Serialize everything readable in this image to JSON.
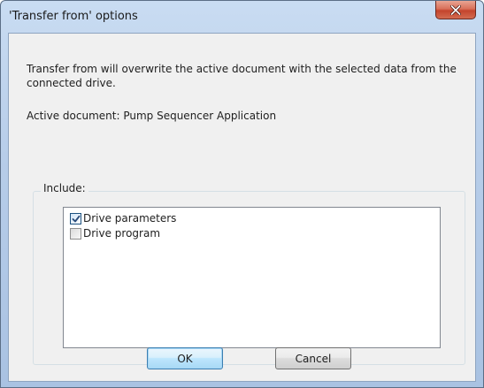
{
  "window": {
    "title": "'Transfer from' options"
  },
  "content": {
    "description": "Transfer from will overwrite the active document with the selected data from the connected drive.",
    "active_document": "Active document: Pump Sequencer Application"
  },
  "include_group": {
    "label": "Include:",
    "items": [
      {
        "label": "Drive parameters",
        "checked": true
      },
      {
        "label": "Drive program",
        "checked": false
      }
    ]
  },
  "buttons": {
    "ok_label": "OK",
    "cancel_label": "Cancel"
  },
  "icons": {
    "close": "close-icon",
    "check": "checkmark-icon"
  },
  "colors": {
    "close_button": "#c4442c",
    "title_bar": "#b7cde9",
    "client_bg": "#f0f0f0",
    "default_button_border": "#3c7fb1"
  }
}
